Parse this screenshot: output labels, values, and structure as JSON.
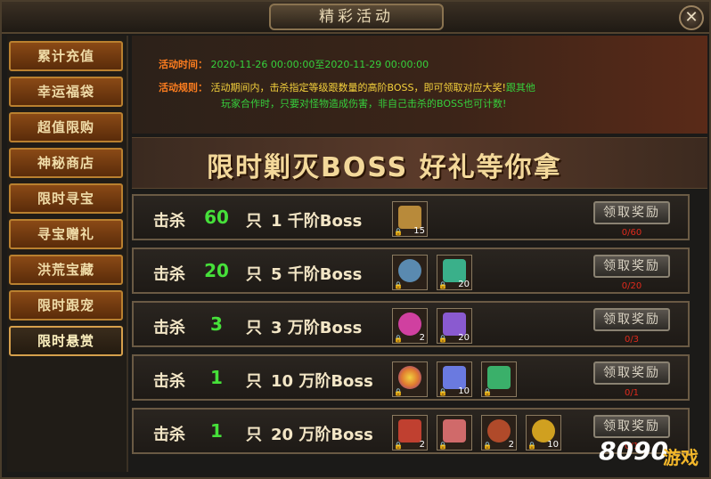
{
  "window": {
    "title": "精彩活动",
    "close_label": "✕"
  },
  "sidebar": {
    "items": [
      {
        "label": "累计充值"
      },
      {
        "label": "幸运福袋"
      },
      {
        "label": "超值限购"
      },
      {
        "label": "神秘商店"
      },
      {
        "label": "限时寻宝"
      },
      {
        "label": "寻宝赠礼"
      },
      {
        "label": "洪荒宝藏"
      },
      {
        "label": "限时跟宠"
      },
      {
        "label": "限时悬赏"
      }
    ],
    "active_index": 8
  },
  "info": {
    "time_label": "活动时间：",
    "time_value": "2020-11-26 00:00:00至2020-11-29 00:00:00",
    "rule_label": "活动规则：",
    "rule_text_1": "活动期间内，击杀指定等级跟数量的高阶BOSS，即可领取对应大奖!",
    "rule_text_1b": "跟其他",
    "rule_text_2": "玩家合作时，只要对怪物造成伤害，非自己击杀的BOSS也可计数!"
  },
  "banner": {
    "text": "限时剿灭BOSS  好礼等你拿"
  },
  "rows": [
    {
      "kill": "击杀",
      "count": "60",
      "unit": "只",
      "desc": "1 千阶Boss",
      "claim": "领取奖励",
      "progress": "0/60",
      "items": [
        {
          "icon": "treasure-chest-icon",
          "count": "15",
          "color": "#b88a3a"
        }
      ]
    },
    {
      "kill": "击杀",
      "count": "20",
      "unit": "只",
      "desc": "5 千阶Boss",
      "claim": "领取奖励",
      "progress": "0/20",
      "items": [
        {
          "icon": "compass-disc-icon",
          "count": "",
          "color": "#5a8ab0"
        },
        {
          "icon": "green-crystal-icon",
          "count": "20",
          "color": "#3ab08a"
        }
      ]
    },
    {
      "kill": "击杀",
      "count": "3",
      "unit": "只",
      "desc": "3 万阶Boss",
      "claim": "领取奖励",
      "progress": "0/3",
      "items": [
        {
          "icon": "pink-gem-icon",
          "count": "2",
          "color": "#d040a0"
        },
        {
          "icon": "purple-crystal-icon",
          "count": "20",
          "color": "#8a5ad0"
        }
      ]
    },
    {
      "kill": "击杀",
      "count": "1",
      "unit": "只",
      "desc": "10 万阶Boss",
      "claim": "领取奖励",
      "progress": "0/1",
      "items": [
        {
          "icon": "rainbow-orb-icon",
          "count": "",
          "color": "#e07a30"
        },
        {
          "icon": "feather-icon",
          "count": "10",
          "color": "#6a7ae0"
        },
        {
          "icon": "green-crystal-icon",
          "count": "",
          "color": "#3ab06a"
        }
      ]
    },
    {
      "kill": "击杀",
      "count": "1",
      "unit": "只",
      "desc": "20 万阶Boss",
      "claim": "领取奖励",
      "progress": "0/1",
      "items": [
        {
          "icon": "staff-icon",
          "count": "2",
          "color": "#c04030"
        },
        {
          "icon": "red-crystal-icon",
          "count": "",
          "color": "#d06a6a"
        },
        {
          "icon": "red-orb-icon",
          "count": "2",
          "color": "#b04a2a"
        },
        {
          "icon": "legend-coin-icon",
          "count": "10",
          "color": "#d0a020"
        }
      ]
    }
  ],
  "logo": {
    "num": "8090",
    "text": "游戏"
  }
}
